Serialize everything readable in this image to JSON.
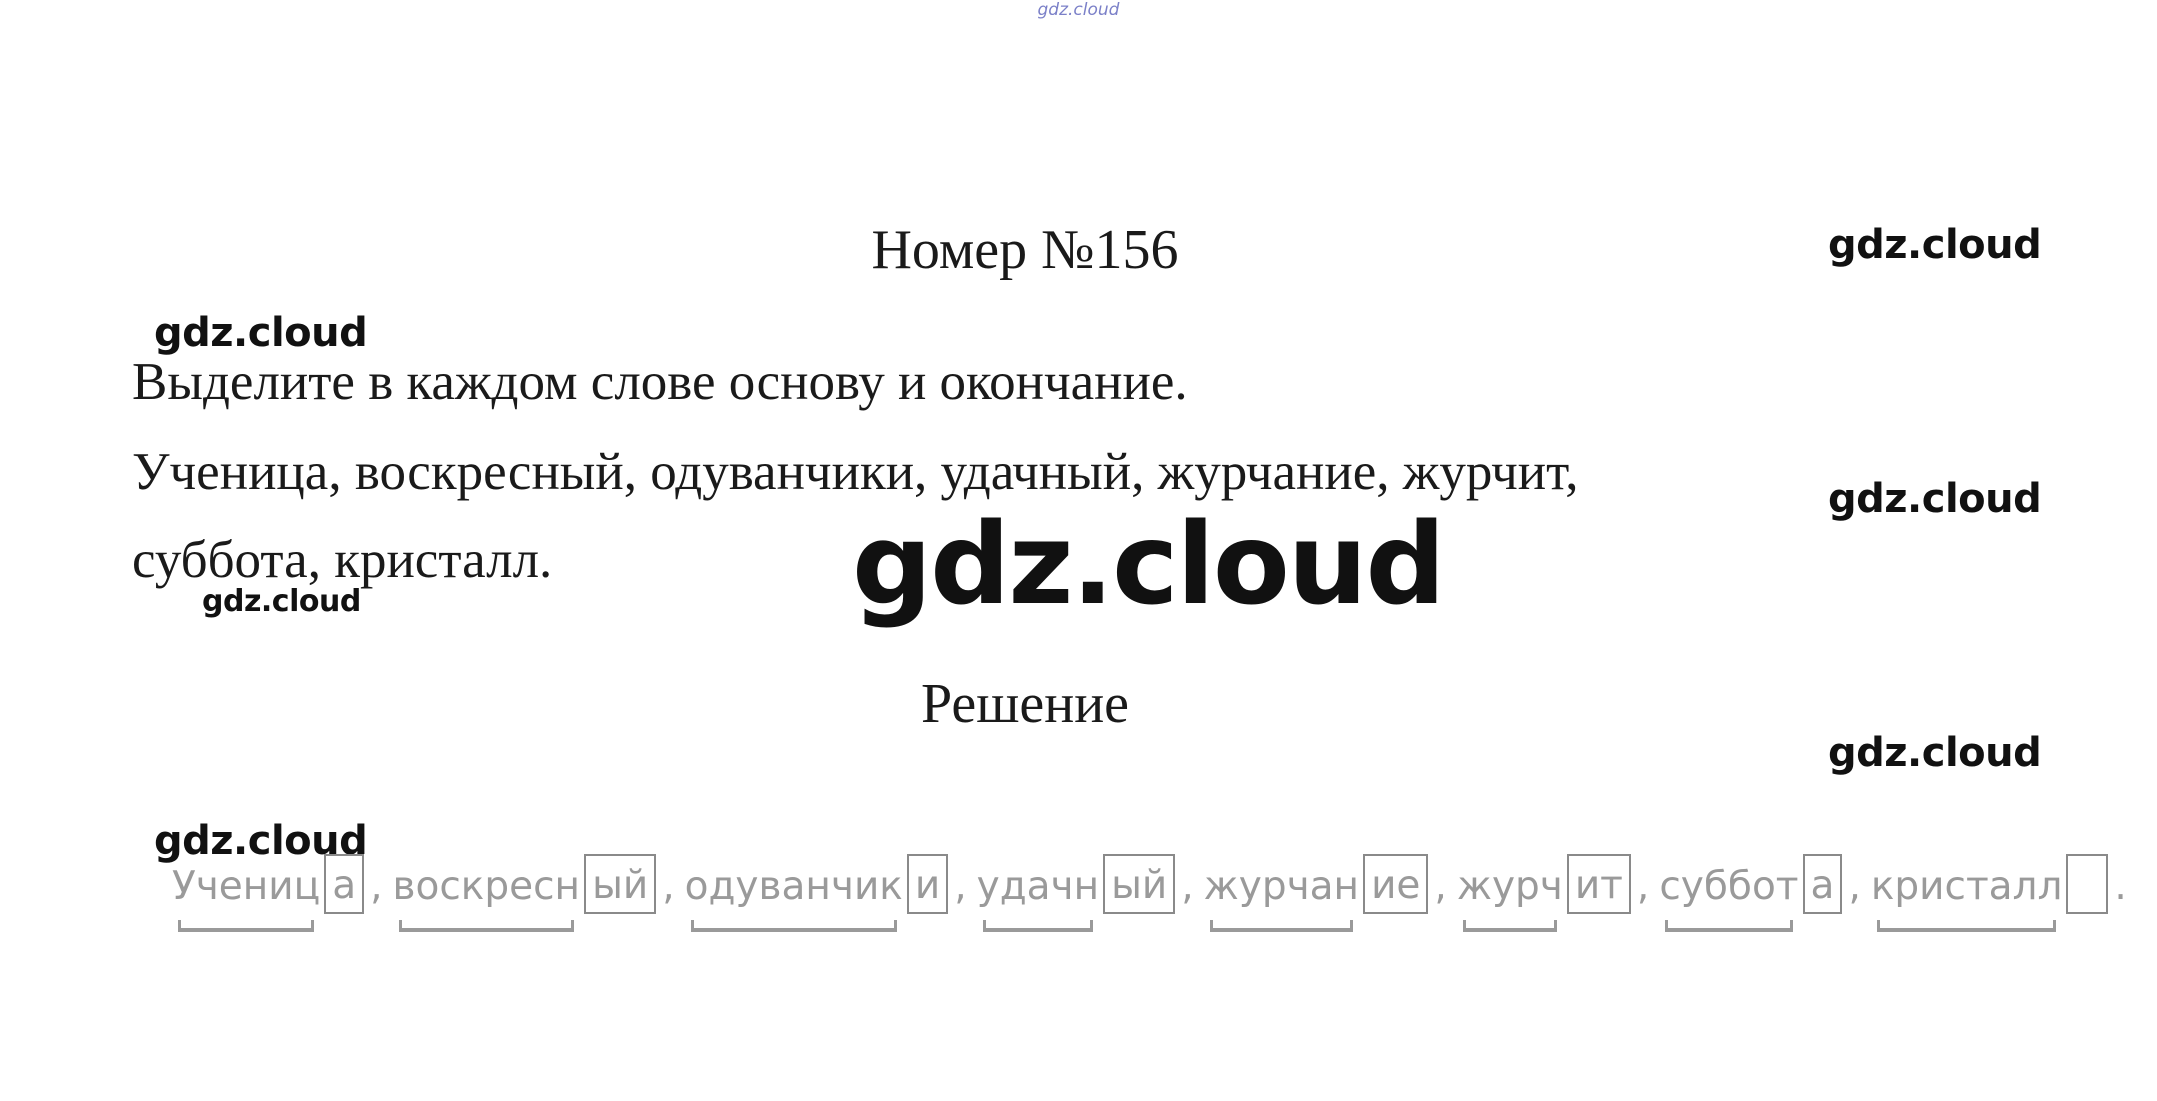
{
  "watermark": {
    "top": "gdz.cloud",
    "right_1": "gdz.cloud",
    "left_1": "gdz.cloud",
    "right_2": "gdz.cloud",
    "center_big": "gdz.cloud",
    "left_small": "gdz.cloud",
    "right_3": "gdz.cloud",
    "left_2": "gdz.cloud"
  },
  "task": {
    "title": "Номер №156",
    "instruction": "Выделите в каждом слове основу и окончание.",
    "words_line_1": "Ученица, воскресный, одуванчики, удачный, журчание, журчит,",
    "words_line_2": "суббота, кристалл."
  },
  "solution": {
    "title": "Решение",
    "words": [
      {
        "stem": "Учениц",
        "ending": "а",
        "sep": ","
      },
      {
        "stem": "воскресн",
        "ending": "ый",
        "sep": ","
      },
      {
        "stem": "одуванчик",
        "ending": "и",
        "sep": ","
      },
      {
        "stem": "удачн",
        "ending": "ый",
        "sep": ","
      },
      {
        "stem": "журчан",
        "ending": "ие",
        "sep": ","
      },
      {
        "stem": "журч",
        "ending": "ит",
        "sep": ","
      },
      {
        "stem": "суббот",
        "ending": "а",
        "sep": ","
      },
      {
        "stem": "кристалл",
        "ending": "",
        "sep": "."
      }
    ]
  }
}
